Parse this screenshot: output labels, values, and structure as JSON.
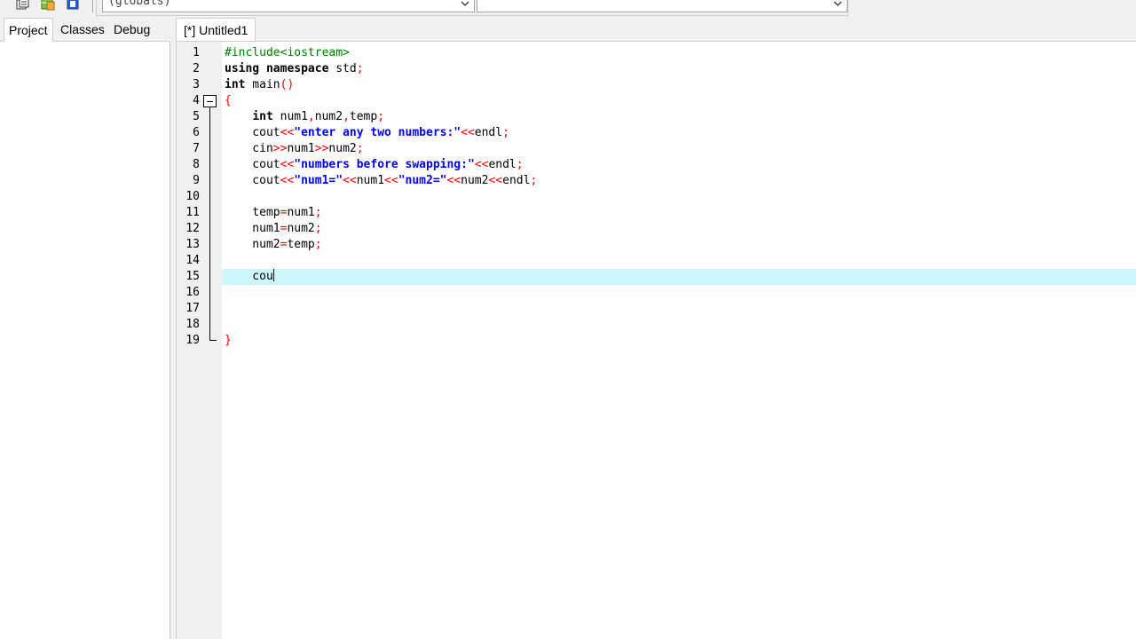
{
  "toolbar": {
    "icons": [
      "copy-icon",
      "add-file-icon",
      "paste-icon"
    ],
    "scope_combo": {
      "value": "(globals)"
    },
    "symbol_combo": {
      "value": ""
    }
  },
  "left_panel": {
    "tabs": [
      {
        "label": "Project",
        "active": true
      },
      {
        "label": "Classes",
        "active": false
      },
      {
        "label": "Debug",
        "active": false
      }
    ]
  },
  "editor": {
    "tab_label": "[*] Untitled1",
    "current_line": 15,
    "lines": [
      {
        "num": "1",
        "tokens": [
          {
            "t": "#include<iostream>",
            "c": "pp"
          }
        ]
      },
      {
        "num": "2",
        "tokens": [
          {
            "t": "using namespace",
            "c": "kw"
          },
          {
            "t": " std",
            "c": ""
          },
          {
            "t": ";",
            "c": "sym"
          }
        ]
      },
      {
        "num": "3",
        "tokens": [
          {
            "t": "int",
            "c": "kw"
          },
          {
            "t": " main",
            "c": ""
          },
          {
            "t": "()",
            "c": "sym"
          }
        ]
      },
      {
        "num": "4",
        "tokens": [
          {
            "t": "{",
            "c": "sym"
          }
        ]
      },
      {
        "num": "5",
        "tokens": [
          {
            "t": "    ",
            "c": ""
          },
          {
            "t": "int",
            "c": "kw"
          },
          {
            "t": " num1",
            "c": ""
          },
          {
            "t": ",",
            "c": "sym"
          },
          {
            "t": "num2",
            "c": ""
          },
          {
            "t": ",",
            "c": "sym"
          },
          {
            "t": "temp",
            "c": ""
          },
          {
            "t": ";",
            "c": "sym"
          }
        ]
      },
      {
        "num": "6",
        "tokens": [
          {
            "t": "    cout",
            "c": ""
          },
          {
            "t": "<<",
            "c": "sym"
          },
          {
            "t": "\"enter any two numbers:\"",
            "c": "str"
          },
          {
            "t": "<<",
            "c": "sym"
          },
          {
            "t": "endl",
            "c": ""
          },
          {
            "t": ";",
            "c": "sym"
          }
        ]
      },
      {
        "num": "7",
        "tokens": [
          {
            "t": "    cin",
            "c": ""
          },
          {
            "t": ">>",
            "c": "sym"
          },
          {
            "t": "num1",
            "c": ""
          },
          {
            "t": ">>",
            "c": "sym"
          },
          {
            "t": "num2",
            "c": ""
          },
          {
            "t": ";",
            "c": "sym"
          }
        ]
      },
      {
        "num": "8",
        "tokens": [
          {
            "t": "    cout",
            "c": ""
          },
          {
            "t": "<<",
            "c": "sym"
          },
          {
            "t": "\"numbers before swapping:\"",
            "c": "str"
          },
          {
            "t": "<<",
            "c": "sym"
          },
          {
            "t": "endl",
            "c": ""
          },
          {
            "t": ";",
            "c": "sym"
          }
        ]
      },
      {
        "num": "9",
        "tokens": [
          {
            "t": "    cout",
            "c": ""
          },
          {
            "t": "<<",
            "c": "sym"
          },
          {
            "t": "\"num1=\"",
            "c": "str"
          },
          {
            "t": "<<",
            "c": "sym"
          },
          {
            "t": "num1",
            "c": ""
          },
          {
            "t": "<<",
            "c": "sym"
          },
          {
            "t": "\"num2=\"",
            "c": "str"
          },
          {
            "t": "<<",
            "c": "sym"
          },
          {
            "t": "num2",
            "c": ""
          },
          {
            "t": "<<",
            "c": "sym"
          },
          {
            "t": "endl",
            "c": ""
          },
          {
            "t": ";",
            "c": "sym"
          }
        ]
      },
      {
        "num": "10",
        "tokens": []
      },
      {
        "num": "11",
        "tokens": [
          {
            "t": "    temp",
            "c": ""
          },
          {
            "t": "=",
            "c": "sym"
          },
          {
            "t": "num1",
            "c": ""
          },
          {
            "t": ";",
            "c": "sym"
          }
        ]
      },
      {
        "num": "12",
        "tokens": [
          {
            "t": "    num1",
            "c": ""
          },
          {
            "t": "=",
            "c": "sym"
          },
          {
            "t": "num2",
            "c": ""
          },
          {
            "t": ";",
            "c": "sym"
          }
        ]
      },
      {
        "num": "13",
        "tokens": [
          {
            "t": "    num2",
            "c": ""
          },
          {
            "t": "=",
            "c": "sym"
          },
          {
            "t": "temp",
            "c": ""
          },
          {
            "t": ";",
            "c": "sym"
          }
        ]
      },
      {
        "num": "14",
        "tokens": []
      },
      {
        "num": "15",
        "tokens": [
          {
            "t": "    cou",
            "c": ""
          }
        ],
        "caret": true
      },
      {
        "num": "16",
        "tokens": []
      },
      {
        "num": "17",
        "tokens": []
      },
      {
        "num": "18",
        "tokens": []
      },
      {
        "num": "19",
        "tokens": [
          {
            "t": "}",
            "c": "sym"
          }
        ]
      }
    ]
  }
}
